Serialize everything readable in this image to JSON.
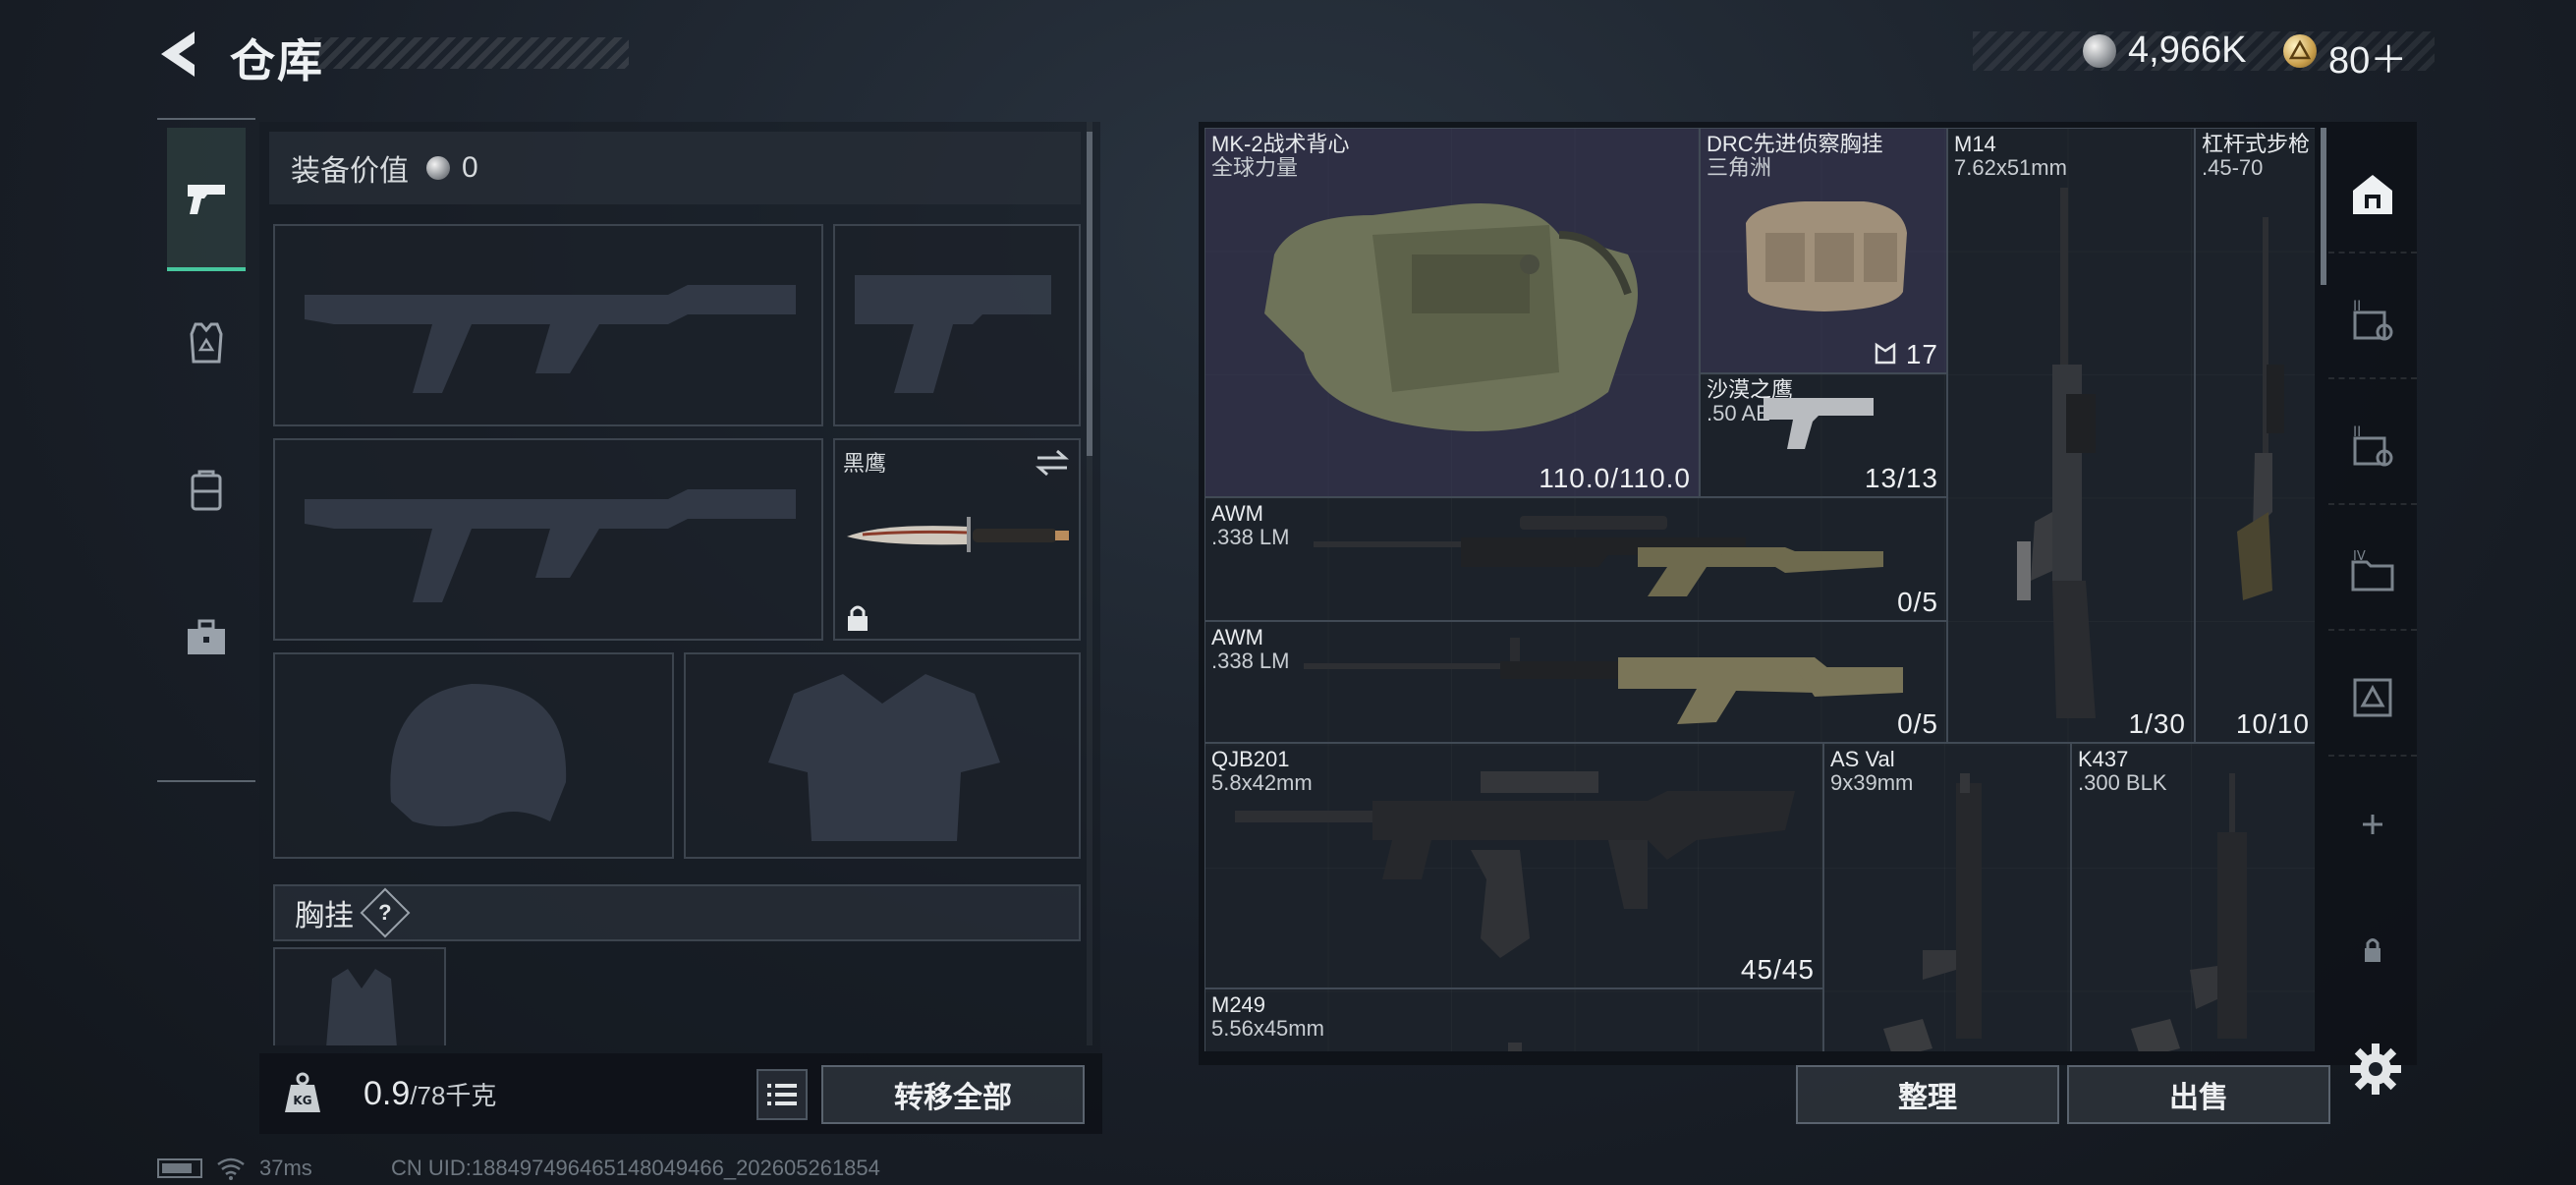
{
  "header": {
    "title": "仓库",
    "currency": [
      {
        "icon": "silver-coin-icon",
        "amount": "4,966K"
      },
      {
        "icon": "gold-triangle-coin-icon",
        "amount": "80＋"
      }
    ]
  },
  "left_sidebar": {
    "tabs": [
      {
        "name": "weapons",
        "icon": "pistol-icon",
        "active": true
      },
      {
        "name": "gear",
        "icon": "armor-icon",
        "active": false
      },
      {
        "name": "backpack",
        "icon": "backpack-icon",
        "active": false
      },
      {
        "name": "supplies",
        "icon": "briefcase-icon",
        "active": false
      }
    ]
  },
  "loadout": {
    "equip_value_label": "装备价值",
    "equip_value": "0",
    "melee_slot": {
      "name": "黑鹰",
      "locked": true
    },
    "chest_rig_label": "胸挂",
    "help": "?"
  },
  "bottom_left": {
    "weight_current": "0.9",
    "weight_max": "/78千克",
    "transfer_all": "转移全部"
  },
  "stash": {
    "items": [
      {
        "name": "MK-2战术背心",
        "sub": "全球力量",
        "count": "110.0/110.0"
      },
      {
        "name": "DRC先进侦察胸挂",
        "sub": "三角洲",
        "count": "17"
      },
      {
        "name": "M14",
        "sub": "7.62x51mm",
        "count": "1/30"
      },
      {
        "name": "杠杆式步枪",
        "sub": ".45-70",
        "count": "10/10"
      },
      {
        "name": "沙漠之鹰",
        "sub": ".50 AE",
        "count": "13/13"
      },
      {
        "name": "AWM",
        "sub": ".338 LM",
        "count": "0/5"
      },
      {
        "name": "AWM",
        "sub": ".338 LM",
        "count": "0/5"
      },
      {
        "name": "QJB201",
        "sub": "5.8x42mm",
        "count": "45/45"
      },
      {
        "name": "AS Val",
        "sub": "9x39mm",
        "count": ""
      },
      {
        "name": "K437",
        "sub": ".300 BLK",
        "count": ""
      },
      {
        "name": "M249",
        "sub": "5.56x45mm",
        "count": ""
      }
    ],
    "sort": "整理",
    "sell": "出售"
  },
  "right_tabs": [
    {
      "icon": "home-storage-icon",
      "active": true
    },
    {
      "icon": "storage-ii-a-icon",
      "active": false
    },
    {
      "icon": "storage-ii-b-icon",
      "active": false
    },
    {
      "icon": "storage-iv-icon",
      "active": false
    },
    {
      "icon": "storage-special-icon",
      "active": false
    },
    {
      "icon": "add-icon",
      "active": false
    },
    {
      "icon": "lock-icon",
      "active": false
    }
  ],
  "status_bar": {
    "ping": "37ms",
    "uid": "CN UID:18849749646514804946​6_202605261854"
  },
  "colors": {
    "accent": "#47c79e",
    "highlight_item": "#34344e",
    "panel": "#1d232b"
  }
}
